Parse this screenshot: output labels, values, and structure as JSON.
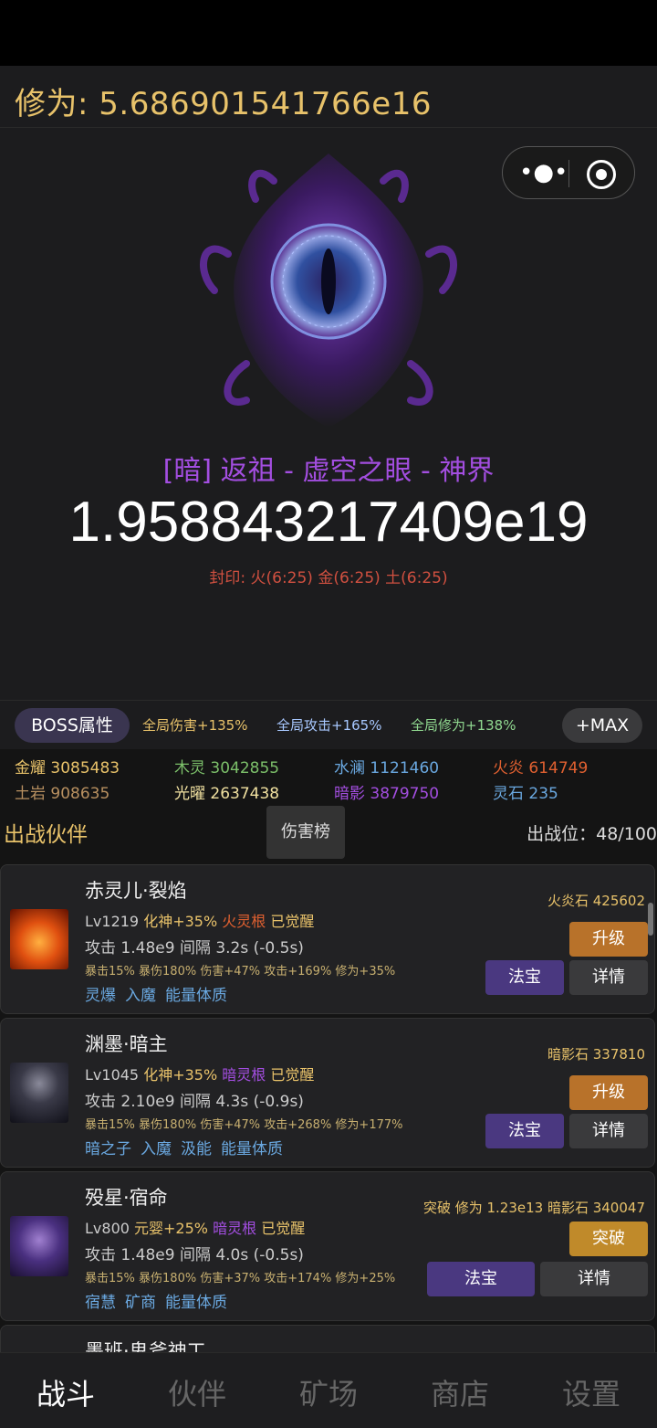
{
  "header": {
    "cultivation": "修为: 5.686901541766e16"
  },
  "capsule": {
    "more_icon": "more-dots-icon",
    "close_icon": "target-icon"
  },
  "boss": {
    "name": "[暗] 返祖 - 虚空之眼 - 神界",
    "hp": "1.958843217409e19",
    "seal": "封印: 火(6:25) 金(6:25) 土(6:25)"
  },
  "buffs": {
    "boss_attr_label": "BOSS属性",
    "damage": "全局伤害+135%",
    "attack": "全局攻击+165%",
    "cultivation": "全局修为+138%",
    "max_label": "+MAX"
  },
  "resources": [
    {
      "label": "金耀",
      "value": "3085483",
      "color": "#e8c26a"
    },
    {
      "label": "木灵",
      "value": "3042855",
      "color": "#7cc06a"
    },
    {
      "label": "水澜",
      "value": "1121460",
      "color": "#6aa8e0"
    },
    {
      "label": "火炎",
      "value": "614749",
      "color": "#e06030"
    },
    {
      "label": "土岩",
      "value": "908635",
      "color": "#b89060"
    },
    {
      "label": "光曜",
      "value": "2637438",
      "color": "#f0e0a0"
    },
    {
      "label": "暗影",
      "value": "3879750",
      "color": "#a34ee0"
    },
    {
      "label": "灵石",
      "value": "235",
      "color": "#6aa8e0"
    }
  ],
  "team": {
    "title": "出战伙伴",
    "rank_label": "伤害榜",
    "slots": "出战位：48/100"
  },
  "companions": [
    {
      "name": "赤灵儿·裂焰",
      "lv": "Lv1219",
      "realm": "化神+35%",
      "root": "火灵根",
      "awake": "已觉醒",
      "attack": "攻击 1.48e9",
      "interval": "间隔 3.2s (-0.5s)",
      "stats": "暴击15% 暴伤180% 伤害+47% 攻击+169% 修为+35%",
      "tags": [
        "灵爆",
        "入魔",
        "能量体质"
      ],
      "stone": "火炎石 425602",
      "action": "升级",
      "fabao": "法宝",
      "detail": "详情",
      "root_color": "#e06030",
      "avatar_color": "#c04010"
    },
    {
      "name": "渊墨·暗主",
      "lv": "Lv1045",
      "realm": "化神+35%",
      "root": "暗灵根",
      "awake": "已觉醒",
      "attack": "攻击 2.10e9",
      "interval": "间隔 4.3s (-0.9s)",
      "stats": "暴击15% 暴伤180% 伤害+47% 攻击+268% 修为+177%",
      "tags": [
        "暗之子",
        "入魔",
        "汲能",
        "能量体质"
      ],
      "stone": "暗影石 337810",
      "action": "升级",
      "fabao": "法宝",
      "detail": "详情",
      "root_color": "#a34ee0",
      "avatar_color": "#2a2a38"
    },
    {
      "name": "殁星·宿命",
      "lv": "Lv800",
      "realm": "元婴+25%",
      "root": "暗灵根",
      "awake": "已觉醒",
      "attack": "攻击 1.48e9",
      "interval": "间隔 4.0s (-0.5s)",
      "stats": "暴击15% 暴伤180% 伤害+37% 攻击+174% 修为+25%",
      "tags": [
        "宿慧",
        "矿商",
        "能量体质"
      ],
      "stone": "突破 修为 1.23e13 暗影石 340047",
      "action": "突破",
      "fabao": "法宝",
      "detail": "详情",
      "root_color": "#a34ee0",
      "avatar_color": "#3a2a60"
    },
    {
      "name": "墨班·鬼斧神工"
    }
  ],
  "nav": [
    "战斗",
    "伙伴",
    "矿场",
    "商店",
    "设置"
  ]
}
